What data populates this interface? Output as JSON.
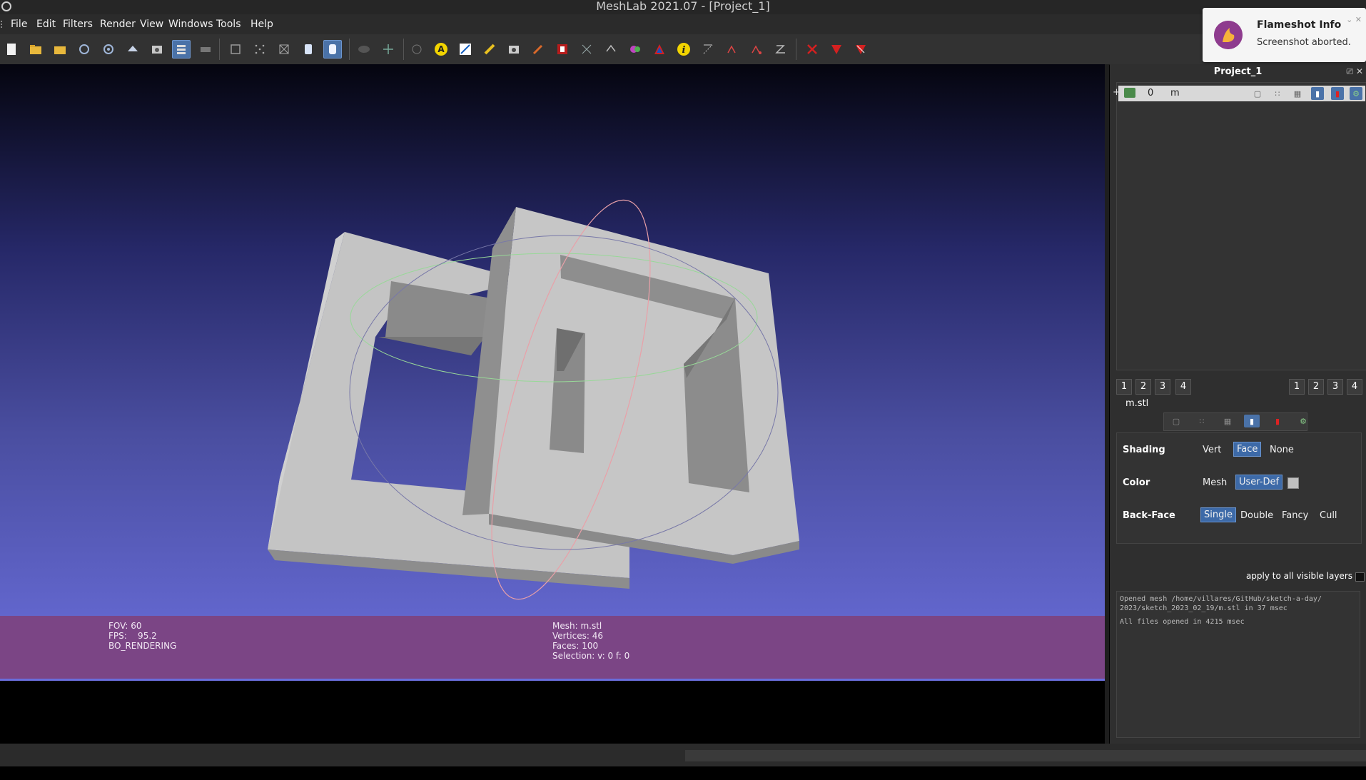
{
  "window": {
    "title": "MeshLab 2021.07 - [Project_1]"
  },
  "menu": [
    "File",
    "Edit",
    "Filters",
    "Render",
    "View",
    "Windows",
    "Tools",
    "Help"
  ],
  "toolbar": {
    "icons": [
      "new-project-icon",
      "open-project-icon",
      "import-mesh-icon",
      "reload-icon",
      "reload-all-icon",
      "export-mesh-icon",
      "snapshot-icon",
      "layers-icon",
      "layer-dialog-icon",
      "bounding-box-icon",
      "points-icon",
      "wireframe-icon",
      "flat-icon",
      "smooth-icon",
      "light-icon",
      "trackball-icon",
      "measure-icon",
      "annotate-icon",
      "align-icon",
      "pick-points-icon",
      "screenshot-icon",
      "paint-icon",
      "text-icon",
      "select-vertex-icon",
      "select-connected-icon",
      "color-paint-icon",
      "delete-icon",
      "info-icon",
      "select-faces-icon",
      "select-area-icon",
      "select-region-icon",
      "select-z-icon",
      "delete-faces-icon",
      "delete-vertices-icon",
      "delete-all-icon"
    ],
    "glyphs": {
      "measure": "A",
      "info": "i"
    }
  },
  "viewport": {
    "info_left": [
      "FOV: 60",
      "FPS:    95.2",
      "BO_RENDERING"
    ],
    "info_right": [
      "Mesh: m.stl",
      "Vertices: 46",
      "Faces: 100",
      "Selection: v: 0 f: 0"
    ]
  },
  "dock": {
    "title": "Project_1",
    "layer": {
      "plus": "+",
      "number": "0",
      "name": "m"
    },
    "left_numbers": [
      "1",
      "2",
      "3",
      "4"
    ],
    "right_numbers": [
      "1",
      "2",
      "3",
      "4"
    ],
    "filename": "m.stl",
    "shading": {
      "label": "Shading",
      "options": [
        "Vert",
        "Face",
        "None"
      ],
      "selected": "Face"
    },
    "color": {
      "label": "Color",
      "options": [
        "Mesh",
        "User-Def"
      ],
      "selected": "User-Def",
      "swatch": "#c0c0c0"
    },
    "backface": {
      "label": "Back-Face",
      "options": [
        "Single",
        "Double",
        "Fancy",
        "Cull"
      ],
      "selected": "Single"
    },
    "apply_label": "apply to all visible layers",
    "log": [
      "Opened mesh /home/villares/GitHub/sketch-a-day/",
      "2023/sketch_2023_02_19/m.stl in 37 msec",
      "All files opened in 4215 msec"
    ]
  },
  "notification": {
    "title": "Flameshot Info",
    "message": "Screenshot aborted."
  },
  "colors": {
    "accent": "#3d6aa8",
    "info_bar": "#7b4585",
    "mesh": "#c0c0c0"
  }
}
